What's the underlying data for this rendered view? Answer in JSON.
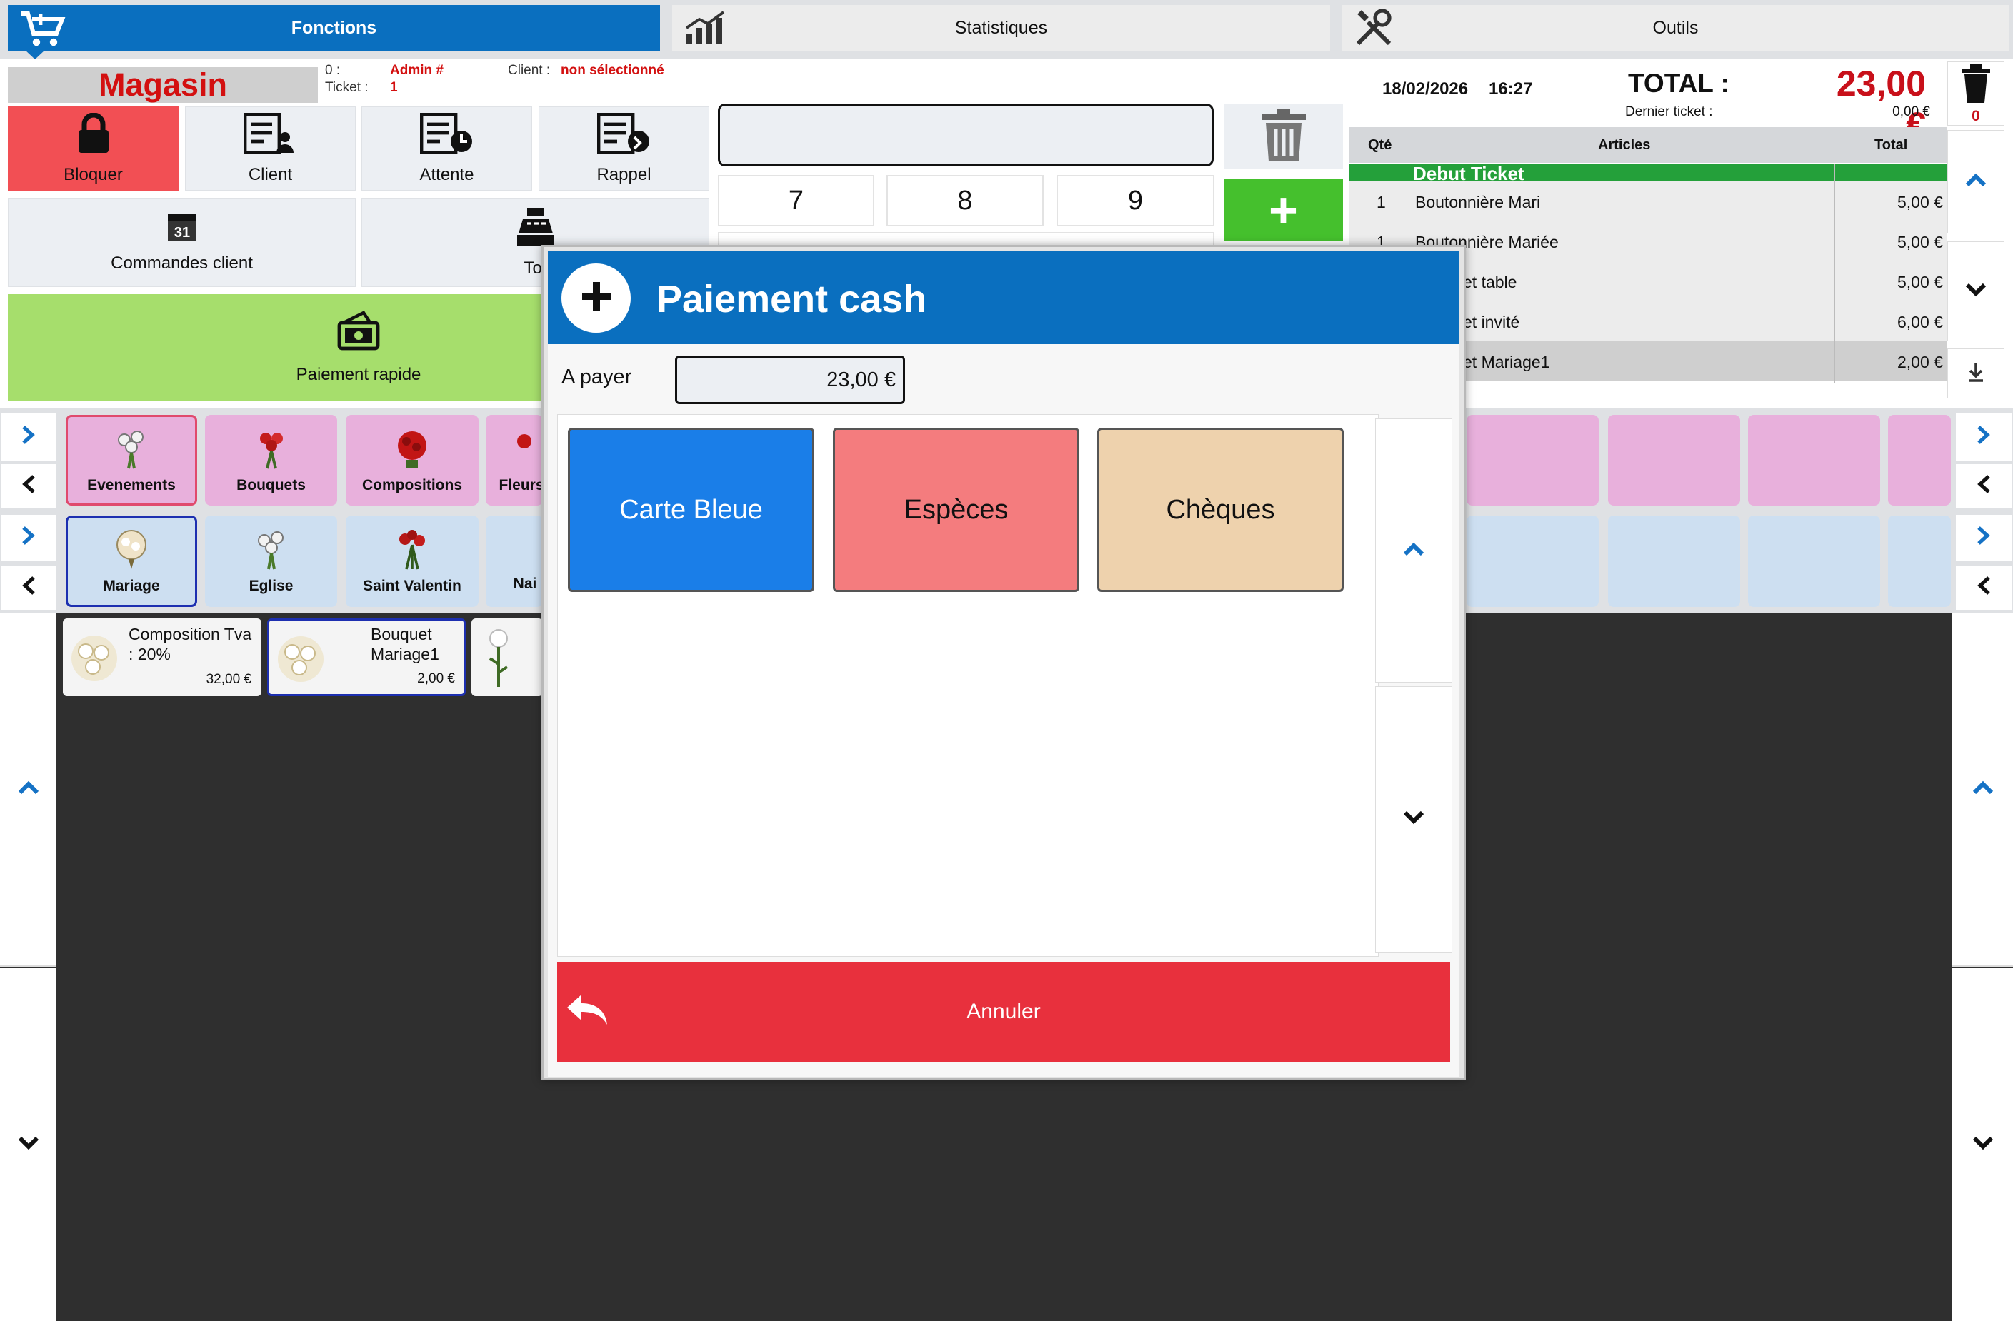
{
  "tabs": [
    {
      "label": "Fonctions",
      "icon": "cart-icon"
    },
    {
      "label": "Statistiques",
      "icon": "chart-icon"
    },
    {
      "label": "Outils",
      "icon": "tools-icon"
    }
  ],
  "header": {
    "store": "Magasin",
    "op_label": "0 :",
    "ticket_label": "Ticket :",
    "user": "Admin #",
    "ticket_no": "1",
    "client_label": "Client :",
    "client_value": "non sélectionné"
  },
  "functions": [
    {
      "label": "Bloquer",
      "icon": "lock-icon"
    },
    {
      "label": "Client",
      "icon": "client-list-icon"
    },
    {
      "label": "Attente",
      "icon": "wait-list-icon"
    },
    {
      "label": "Rappel",
      "icon": "recall-list-icon"
    },
    {
      "label": "Commandes client",
      "icon": "calendar-icon"
    },
    {
      "label": "Tot",
      "icon": "cash-register-icon"
    },
    {
      "label": "Paiement rapide",
      "icon": "cash-icon"
    }
  ],
  "keypad": {
    "k7": "7",
    "k8": "8",
    "k9": "9",
    "plus": "+"
  },
  "ticket": {
    "date": "18/02/2026",
    "time": "16:27",
    "total_label": "TOTAL :",
    "total": "23,00 €",
    "last_label": "Dernier ticket :",
    "last_value": "0,00 €",
    "trash_count": "0",
    "col_qty": "Qté",
    "col_articles": "Articles",
    "col_total": "Total",
    "start": "Debut Ticket",
    "rows": [
      {
        "qty": "1",
        "name": "Boutonnière Mari",
        "total": "5,00 €"
      },
      {
        "qty": "1",
        "name": "Boutonnière Mariée",
        "total": "5,00 €"
      },
      {
        "qty": "",
        "name": "et table",
        "total": "5,00 €"
      },
      {
        "qty": "",
        "name": "et invité",
        "total": "6,00 €"
      },
      {
        "qty": "",
        "name": "et Mariage1",
        "total": "2,00 €"
      }
    ]
  },
  "categories": [
    {
      "label": "Evenements"
    },
    {
      "label": "Bouquets"
    },
    {
      "label": "Compositions"
    },
    {
      "label": "Fleurs"
    }
  ],
  "subcategories": [
    {
      "label": "Mariage"
    },
    {
      "label": "Eglise"
    },
    {
      "label": "Saint Valentin"
    },
    {
      "label": "Nai"
    }
  ],
  "products": [
    {
      "name": "Composition Tva : 20%",
      "price": "32,00 €"
    },
    {
      "name": "Bouquet Mariage1",
      "price": "2,00 €"
    },
    {
      "name": "",
      "price": ""
    }
  ],
  "modal": {
    "title": "Paiement cash",
    "pay_label": "A payer",
    "pay_value": "23,00 €",
    "methods": [
      {
        "label": "Carte Bleue",
        "color": "#1a7ee8"
      },
      {
        "label": "Espèces",
        "color": "#f47c7e"
      },
      {
        "label": "Chèques",
        "color": "#eed2ad"
      }
    ],
    "cancel": "Annuler"
  }
}
